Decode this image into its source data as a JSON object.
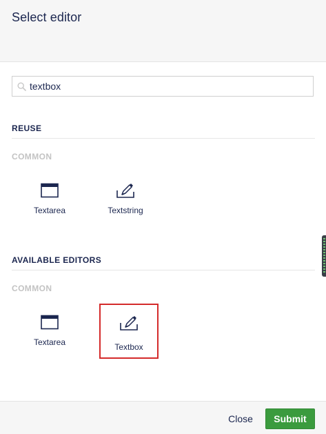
{
  "dialog": {
    "title": "Select editor"
  },
  "search": {
    "value": "textbox",
    "placeholder": ""
  },
  "sections": {
    "reuse": {
      "title": "REUSE",
      "group": "COMMON",
      "items": [
        {
          "label": "Textarea",
          "icon": "window-icon"
        },
        {
          "label": "Textstring",
          "icon": "edit-pen-icon"
        }
      ]
    },
    "available": {
      "title": "AVAILABLE EDITORS",
      "group": "COMMON",
      "items": [
        {
          "label": "Textarea",
          "icon": "window-icon"
        },
        {
          "label": "Textbox",
          "icon": "edit-pen-icon",
          "selected": true
        }
      ]
    }
  },
  "footer": {
    "close_label": "Close",
    "submit_label": "Submit"
  },
  "colors": {
    "submit": "#3b9b3e",
    "selection_outline": "#d42a2a",
    "text": "#1b264f",
    "muted": "#c3c3c3"
  }
}
